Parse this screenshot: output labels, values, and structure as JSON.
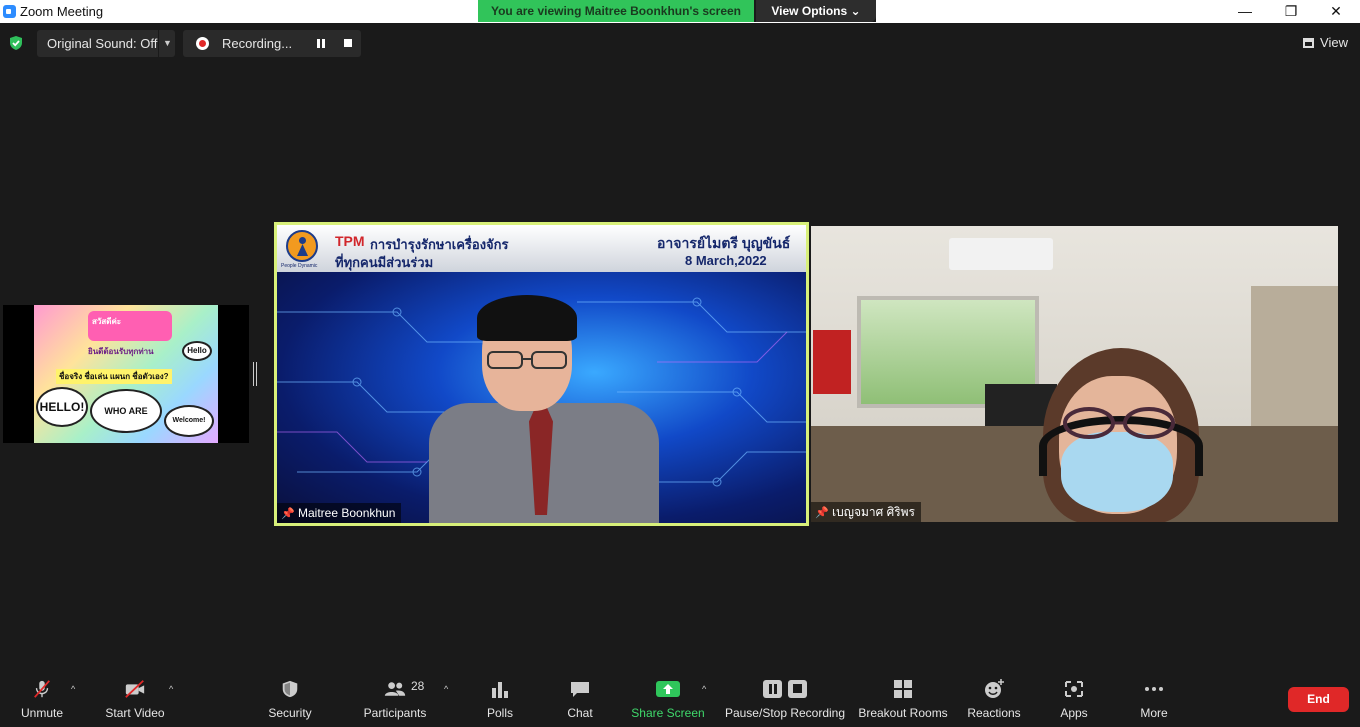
{
  "window": {
    "title": "Zoom Meeting",
    "banner": "You are viewing Maitree Boonkhun's screen",
    "view_options": "View Options",
    "minimize": "—",
    "restore": "❐",
    "close": "✕"
  },
  "top_bar": {
    "original_sound": "Original Sound: Off",
    "recording": "Recording...",
    "view": "View"
  },
  "thumbnail": {
    "lines": [
      "สวัสดีค่ะ",
      "ยินดีต้อนรับทุกท่าน",
      "ชื่อจริง ชื่อเล่น แผนก ชื่อตัวเอง?"
    ],
    "hello_small": "Hello",
    "hello_big": "HELLO!",
    "who": "WHO ARE YOU?",
    "welcome": "Welcome!"
  },
  "main_tile": {
    "slide_tpm": "TPM",
    "slide_title": "การบำรุงรักษาเครื่องจักร",
    "slide_subtitle": "ที่ทุกคนมีส่วนร่วม",
    "slide_teacher": "อาจารย์ไมตรี บุญขันธ์",
    "slide_date": "8 March,2022",
    "logo_caption": "People Dynamic",
    "participant_name": "Maitree Boonkhun"
  },
  "cam_tile": {
    "participant_name": "เบญจมาศ  ศิริพร"
  },
  "toolbar": {
    "unmute": "Unmute",
    "start_video": "Start Video",
    "security": "Security",
    "participants": "Participants",
    "participants_count": "28",
    "polls": "Polls",
    "chat": "Chat",
    "share_screen": "Share Screen",
    "pause_stop_recording": "Pause/Stop Recording",
    "breakout_rooms": "Breakout Rooms",
    "reactions": "Reactions",
    "apps": "Apps",
    "more": "More",
    "end": "End"
  }
}
